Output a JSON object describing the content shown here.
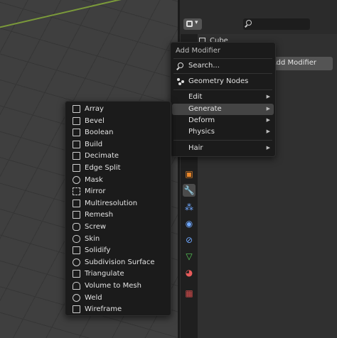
{
  "add_modifier_button": "Add Modifier",
  "object_name": "Cube",
  "menu": {
    "title": "Add Modifier",
    "search_label": "Search...",
    "geometry_nodes_label": "Geometry Nodes",
    "items": [
      {
        "label": "Edit",
        "has_submenu": true
      },
      {
        "label": "Generate",
        "has_submenu": true,
        "highlighted": true
      },
      {
        "label": "Deform",
        "has_submenu": true
      },
      {
        "label": "Physics",
        "has_submenu": true
      },
      {
        "label": "Hair",
        "has_submenu": true
      }
    ]
  },
  "generate_submenu": {
    "items": [
      {
        "label": "Array",
        "icon": "array-icon"
      },
      {
        "label": "Bevel",
        "icon": "bevel-icon"
      },
      {
        "label": "Boolean",
        "icon": "boolean-icon"
      },
      {
        "label": "Build",
        "icon": "build-icon"
      },
      {
        "label": "Decimate",
        "icon": "decimate-icon"
      },
      {
        "label": "Edge Split",
        "icon": "edge-split-icon"
      },
      {
        "label": "Mask",
        "icon": "mask-icon"
      },
      {
        "label": "Mirror",
        "icon": "mirror-icon"
      },
      {
        "label": "Multiresolution",
        "icon": "multiresolution-icon"
      },
      {
        "label": "Remesh",
        "icon": "remesh-icon"
      },
      {
        "label": "Screw",
        "icon": "screw-icon"
      },
      {
        "label": "Skin",
        "icon": "skin-icon"
      },
      {
        "label": "Solidify",
        "icon": "solidify-icon"
      },
      {
        "label": "Subdivision Surface",
        "icon": "subdivision-surface-icon"
      },
      {
        "label": "Triangulate",
        "icon": "triangulate-icon"
      },
      {
        "label": "Volume to Mesh",
        "icon": "volume-to-mesh-icon"
      },
      {
        "label": "Weld",
        "icon": "weld-icon"
      },
      {
        "label": "Wireframe",
        "icon": "wireframe-icon"
      }
    ]
  },
  "property_tabs": [
    {
      "icon": "object-tab-icon",
      "color": "#e8872a"
    },
    {
      "icon": "modifier-tab-icon",
      "color": "#6fa8ff",
      "active": true
    },
    {
      "icon": "particles-tab-icon",
      "color": "#6fa8ff"
    },
    {
      "icon": "physics-tab-icon",
      "color": "#6fa8ff"
    },
    {
      "icon": "constraints-tab-icon",
      "color": "#6fa8ff"
    },
    {
      "icon": "data-tab-icon",
      "color": "#59d05a"
    },
    {
      "icon": "material-tab-icon",
      "color": "#e85b5b"
    },
    {
      "icon": "texture-tab-icon",
      "color": "#d04b4b"
    }
  ]
}
